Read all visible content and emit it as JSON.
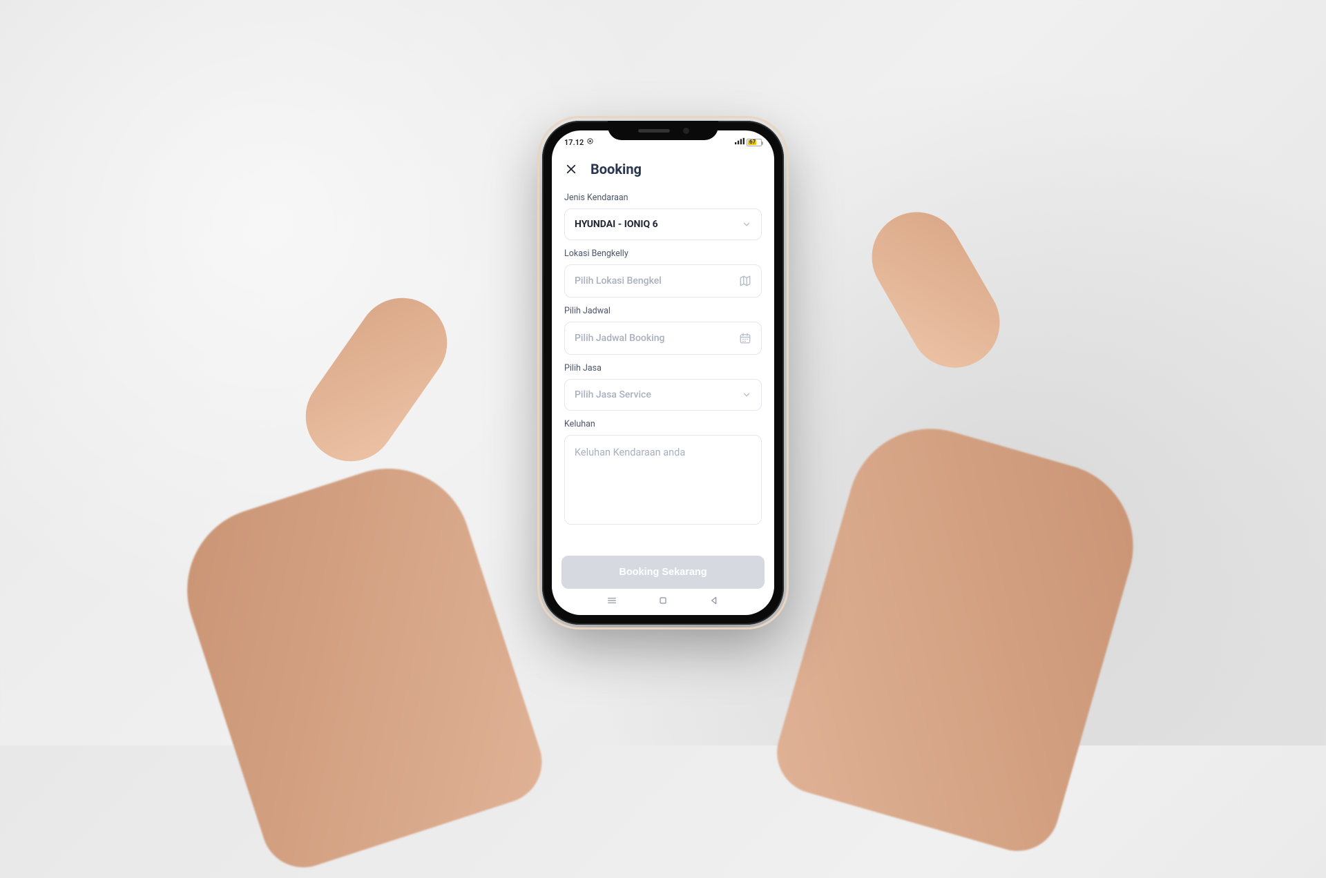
{
  "status": {
    "time": "17.12",
    "battery_level": "67"
  },
  "header": {
    "title": "Booking"
  },
  "form": {
    "vehicle_label": "Jenis Kendaraan",
    "vehicle_value": "HYUNDAI - IONIQ 6",
    "location_label": "Lokasi Bengkelly",
    "location_placeholder": "Pilih Lokasi Bengkel",
    "schedule_label": "Pilih Jadwal",
    "schedule_placeholder": "Pilih Jadwal Booking",
    "service_label": "Pilih Jasa",
    "service_placeholder": "Pilih Jasa Service",
    "complaint_label": "Keluhan",
    "complaint_placeholder": "Keluhan Kendaraan anda"
  },
  "cta": {
    "label": "Booking Sekarang"
  }
}
